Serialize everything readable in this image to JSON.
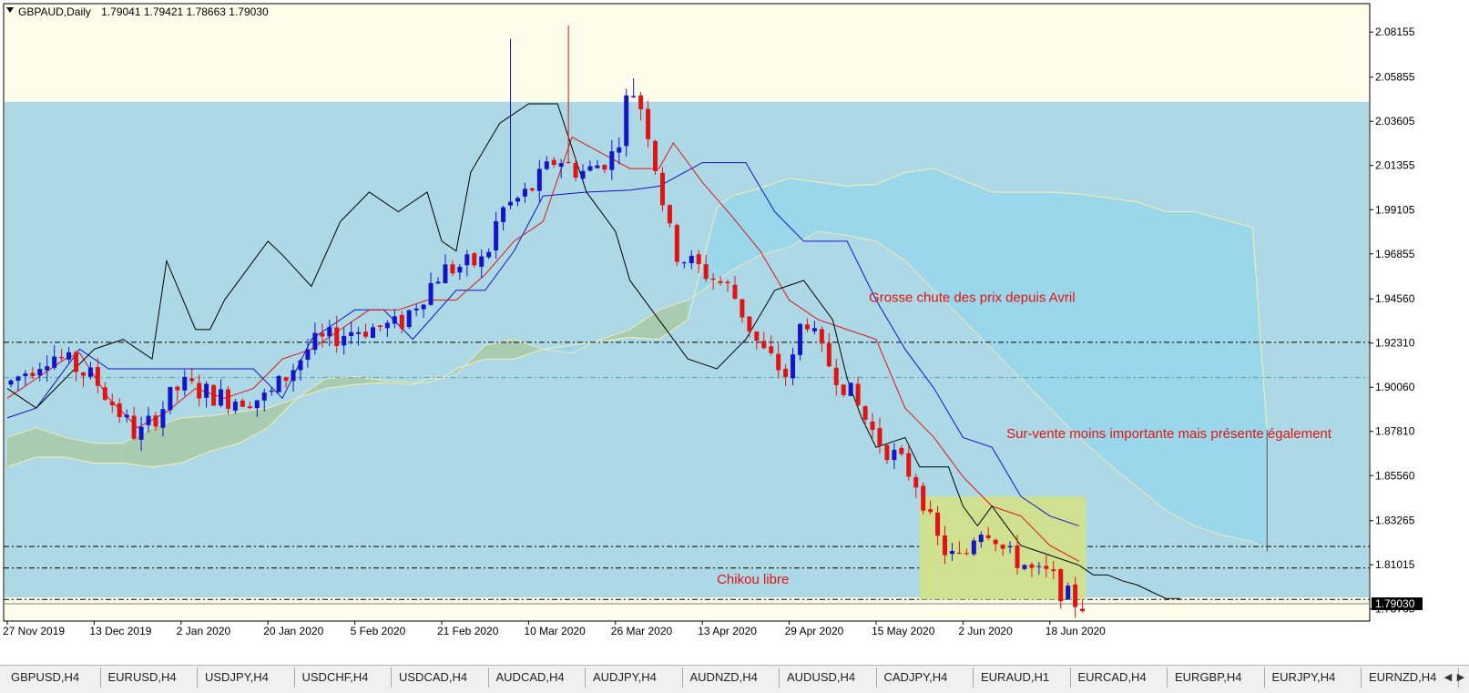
{
  "chart_data": {
    "type": "candlestick",
    "symbol_header": "GBPAUD,Daily",
    "ohlc_header": "1.79041 1.79421 1.78663 1.79030",
    "current_price_label": "1.79030",
    "ylim": [
      1.7815,
      2.096
    ],
    "y_tick_labels": [
      "2.08155",
      "2.05855",
      "2.03605",
      "2.01355",
      "1.99105",
      "1.96855",
      "1.94560",
      "1.92310",
      "1.90060",
      "1.87810",
      "1.85560",
      "1.83265",
      "1.81015",
      "1.78765"
    ],
    "y_tick_values": [
      2.08155,
      2.05855,
      2.03605,
      2.01355,
      1.99105,
      1.96855,
      1.9456,
      1.9231,
      1.9006,
      1.8781,
      1.8556,
      1.83265,
      1.81015,
      1.78765
    ],
    "x_tick_labels": [
      "27 Nov 2019",
      "13 Dec 2019",
      "2 Jan 2020",
      "20 Jan 2020",
      "5 Feb 2020",
      "21 Feb 2020",
      "10 Mar 2020",
      "26 Mar 2020",
      "13 Apr 2020",
      "29 Apr 2020",
      "15 May 2020",
      "2 Jun 2020",
      "18 Jun 2020"
    ],
    "x_tick_bar_index": [
      0,
      12,
      24,
      36,
      48,
      60,
      72,
      84,
      96,
      108,
      120,
      132,
      144
    ],
    "bar_count": 149,
    "future_bars": 26,
    "horizontal_levels": [
      1.9235,
      1.8195,
      1.8085,
      1.7925
    ],
    "levels_secondary": [
      1.9055
    ],
    "shaded_zone": {
      "price_top": 2.046,
      "price_bottom": 1.7935
    },
    "highlight_box": {
      "bar_start": 126,
      "bar_end": 149,
      "price_top": 1.845,
      "price_bottom": 1.7925
    },
    "vertical_marker": {
      "bar": 174,
      "price_top": 1.879,
      "price_bottom": 1.817
    },
    "annotations": [
      {
        "text": "Grosse chute des prix depuis Avril",
        "bar": 119,
        "price": 1.944
      },
      {
        "text": "Sur-vente moins importante mais présente également",
        "bar": 138,
        "price": 1.8748
      },
      {
        "text": "Chikou libre",
        "bar": 98,
        "price": 1.8005
      }
    ],
    "price_path": {
      "bars": [
        0,
        6,
        12,
        18,
        24,
        30,
        36,
        42,
        48,
        54,
        60,
        66,
        68,
        72,
        76,
        78,
        80,
        84,
        86,
        88,
        92,
        96,
        100,
        104,
        108,
        110,
        112,
        116,
        120,
        124,
        126,
        128,
        130,
        132,
        134,
        136,
        138,
        140,
        142,
        144,
        146,
        148
      ],
      "values": [
        1.902,
        1.918,
        1.905,
        1.875,
        1.902,
        1.895,
        1.895,
        1.922,
        1.93,
        1.932,
        1.96,
        1.965,
        1.99,
        2.0,
        2.018,
        2.012,
        2.01,
        2.02,
        2.055,
        2.04,
        1.97,
        1.96,
        1.95,
        1.92,
        1.905,
        1.94,
        1.92,
        1.9,
        1.875,
        1.86,
        1.85,
        1.825,
        1.815,
        1.812,
        1.83,
        1.828,
        1.815,
        1.812,
        1.805,
        1.805,
        1.795,
        1.79
      ]
    },
    "series": [
      {
        "points": [
          [
            0,
            1.885
          ],
          [
            4,
            1.89
          ],
          [
            8,
            1.91
          ],
          [
            10,
            1.92
          ],
          [
            14,
            1.91
          ],
          [
            20,
            1.91
          ],
          [
            26,
            1.91
          ],
          [
            34,
            1.91
          ],
          [
            38,
            1.895
          ],
          [
            42,
            1.925
          ],
          [
            48,
            1.94
          ],
          [
            52,
            1.94
          ],
          [
            56,
            1.925
          ],
          [
            62,
            1.95
          ],
          [
            66,
            1.95
          ],
          [
            70,
            1.97
          ],
          [
            74,
            1.998
          ],
          [
            80,
            2.0
          ],
          [
            86,
            2.001
          ],
          [
            90,
            2.003
          ],
          [
            96,
            2.015
          ],
          [
            102,
            2.015
          ],
          [
            106,
            1.99
          ],
          [
            110,
            1.975
          ],
          [
            116,
            1.975
          ],
          [
            120,
            1.945
          ],
          [
            124,
            1.92
          ],
          [
            128,
            1.9
          ],
          [
            132,
            1.875
          ],
          [
            136,
            1.87
          ],
          [
            140,
            1.845
          ],
          [
            144,
            1.835
          ],
          [
            148,
            1.83
          ]
        ]
      },
      {
        "points": [
          [
            0,
            1.895
          ],
          [
            4,
            1.905
          ],
          [
            8,
            1.915
          ],
          [
            10,
            1.918
          ],
          [
            14,
            1.895
          ],
          [
            18,
            1.88
          ],
          [
            22,
            1.888
          ],
          [
            26,
            1.9
          ],
          [
            30,
            1.895
          ],
          [
            34,
            1.9
          ],
          [
            38,
            1.915
          ],
          [
            42,
            1.92
          ],
          [
            46,
            1.93
          ],
          [
            50,
            1.94
          ],
          [
            54,
            1.94
          ],
          [
            58,
            1.945
          ],
          [
            62,
            1.945
          ],
          [
            66,
            1.958
          ],
          [
            70,
            1.975
          ],
          [
            74,
            1.985
          ],
          [
            78,
            2.028
          ],
          [
            82,
            2.02
          ],
          [
            86,
            2.012
          ],
          [
            90,
            2.012
          ],
          [
            92,
            2.025
          ],
          [
            96,
            2.005
          ],
          [
            100,
            1.988
          ],
          [
            104,
            1.97
          ],
          [
            108,
            1.945
          ],
          [
            112,
            1.935
          ],
          [
            116,
            1.93
          ],
          [
            120,
            1.925
          ],
          [
            124,
            1.89
          ],
          [
            128,
            1.875
          ],
          [
            132,
            1.855
          ],
          [
            136,
            1.84
          ],
          [
            140,
            1.835
          ],
          [
            144,
            1.82
          ],
          [
            148,
            1.812
          ]
        ]
      },
      {
        "points": [
          [
            0,
            1.9
          ],
          [
            4,
            1.89
          ],
          [
            8,
            1.905
          ],
          [
            12,
            1.92
          ],
          [
            16,
            1.925
          ],
          [
            20,
            1.915
          ],
          [
            22,
            1.965
          ],
          [
            26,
            1.93
          ],
          [
            28,
            1.93
          ],
          [
            30,
            1.945
          ],
          [
            34,
            1.965
          ],
          [
            36,
            1.975
          ],
          [
            38,
            1.968
          ],
          [
            42,
            1.952
          ],
          [
            46,
            1.985
          ],
          [
            50,
            2.0
          ],
          [
            54,
            1.99
          ],
          [
            58,
            2.0
          ],
          [
            60,
            1.975
          ],
          [
            62,
            1.97
          ],
          [
            64,
            2.01
          ],
          [
            68,
            2.035
          ],
          [
            72,
            2.045
          ],
          [
            76,
            2.045
          ],
          [
            80,
            2.0
          ],
          [
            84,
            1.98
          ],
          [
            86,
            1.955
          ],
          [
            90,
            1.935
          ],
          [
            94,
            1.915
          ],
          [
            98,
            1.91
          ],
          [
            102,
            1.925
          ],
          [
            106,
            1.95
          ],
          [
            110,
            1.955
          ],
          [
            114,
            1.935
          ],
          [
            116,
            1.905
          ],
          [
            118,
            1.885
          ],
          [
            120,
            1.87
          ],
          [
            124,
            1.875
          ],
          [
            126,
            1.86
          ],
          [
            130,
            1.86
          ],
          [
            132,
            1.84
          ],
          [
            134,
            1.83
          ],
          [
            136,
            1.84
          ],
          [
            138,
            1.83
          ],
          [
            140,
            1.82
          ],
          [
            144,
            1.815
          ],
          [
            148,
            1.81
          ],
          [
            150,
            1.805
          ],
          [
            152,
            1.805
          ],
          [
            154,
            1.802
          ],
          [
            156,
            1.8
          ],
          [
            160,
            1.793
          ],
          [
            162,
            1.793
          ]
        ]
      }
    ],
    "cloud": {
      "bars": [
        0,
        4,
        8,
        12,
        16,
        20,
        24,
        28,
        32,
        36,
        40,
        44,
        48,
        52,
        56,
        58,
        60,
        62,
        66,
        70,
        74,
        78,
        82,
        86,
        90,
        94,
        98,
        100,
        104,
        108,
        112,
        116,
        120,
        124,
        128,
        132,
        136,
        140,
        144,
        148,
        152,
        156,
        160,
        164,
        168,
        172,
        174
      ],
      "span_a": [
        1.86,
        1.865,
        1.865,
        1.862,
        1.862,
        1.86,
        1.862,
        1.868,
        1.872,
        1.88,
        1.895,
        1.9,
        1.902,
        1.903,
        1.902,
        1.905,
        1.905,
        1.91,
        1.915,
        1.915,
        1.92,
        1.922,
        1.924,
        1.926,
        1.925,
        1.935,
        1.992,
        1.998,
        2.002,
        2.007,
        2.005,
        2.003,
        2.004,
        2.01,
        2.012,
        2.006,
        2.0,
        2.0,
        2.0,
        1.999,
        1.997,
        1.995,
        1.99,
        1.99,
        1.986,
        1.982,
        1.878
      ],
      "span_b": [
        1.875,
        1.88,
        1.875,
        1.872,
        1.872,
        1.88,
        1.885,
        1.886,
        1.888,
        1.89,
        1.895,
        1.905,
        1.906,
        1.904,
        1.903,
        1.903,
        1.905,
        1.907,
        1.922,
        1.925,
        1.92,
        1.918,
        1.925,
        1.93,
        1.94,
        1.945,
        1.955,
        1.96,
        1.968,
        1.972,
        1.98,
        1.978,
        1.975,
        1.965,
        1.95,
        1.935,
        1.92,
        1.905,
        1.89,
        1.875,
        1.862,
        1.85,
        1.838,
        1.83,
        1.825,
        1.822,
        1.818
      ]
    },
    "colors": {
      "background": "#fefdeb",
      "zone": "#add8e5",
      "cloud_bull": "#9ad7ea",
      "cloud_bear": "#a9ccb1",
      "bull": "#1414c8",
      "bear": "#e01414",
      "tenkan": "#e01414",
      "kijun": "#1414c8",
      "chikou": "#000000",
      "highlight": "#cfe090",
      "annotation_text": "#e01414"
    }
  },
  "tabs": [
    "GBPUSD,H4",
    "EURUSD,H4",
    "USDJPY,H4",
    "USDCHF,H4",
    "USDCAD,H4",
    "AUDCAD,H4",
    "AUDJPY,H4",
    "AUDNZD,H4",
    "AUDUSD,H4",
    "CADJPY,H4",
    "EURAUD,H1",
    "EURCAD,H4",
    "EURGBP,H4",
    "EURJPY,H4",
    "EURNZD,H4"
  ],
  "tab_scroll_left": "◀",
  "tab_scroll_right": "▶"
}
